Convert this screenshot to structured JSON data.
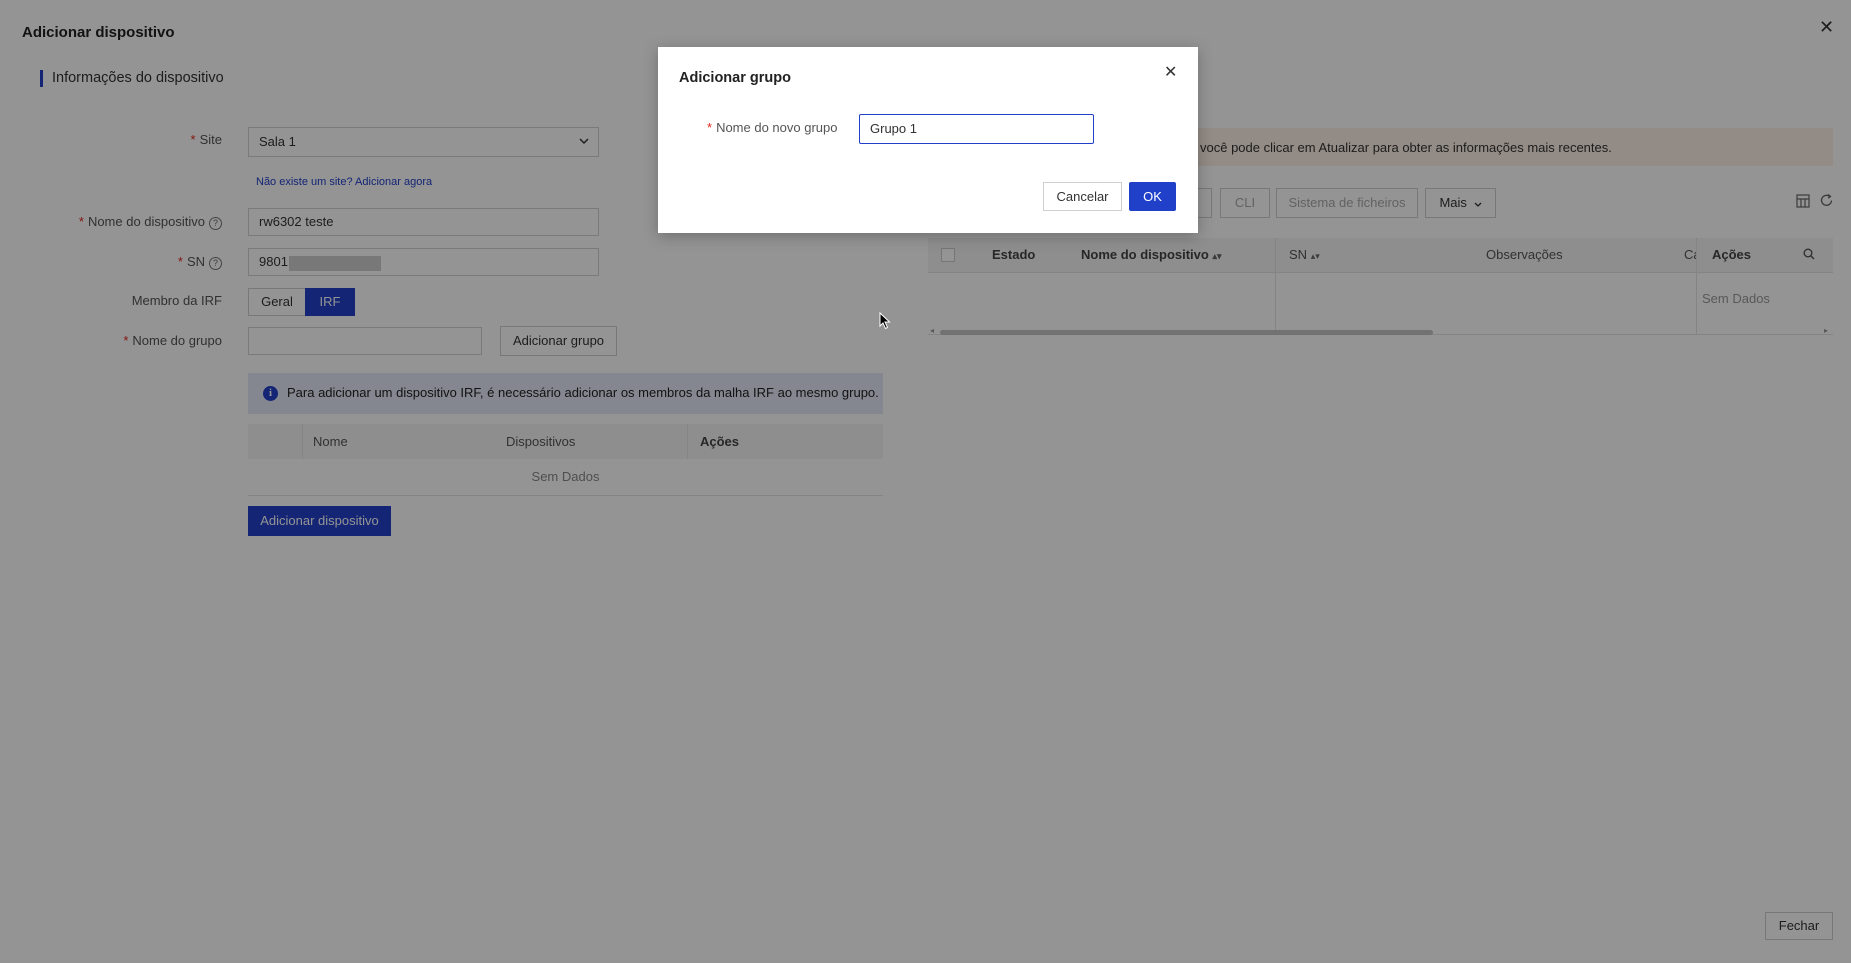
{
  "page": {
    "title": "Adicionar dispositivo"
  },
  "section": {
    "title": "Informações do dispositivo"
  },
  "form": {
    "site_label": "Site",
    "site_value": "Sala 1",
    "site_link": "Não existe um site? Adicionar agora",
    "device_name_label": "Nome do dispositivo",
    "device_name_value": "rw6302 teste",
    "sn_label": "SN",
    "sn_value": "9801",
    "irf_label": "Membro da IRF",
    "irf_options": [
      "Geral",
      "IRF"
    ],
    "irf_selected": "IRF",
    "group_label": "Nome do grupo",
    "group_value": "",
    "add_group_button": "Adicionar grupo",
    "info_text": "Para adicionar um dispositivo IRF, é necessário adicionar os membros da malha IRF ao mesmo grupo.",
    "group_table": {
      "columns": [
        "Nome",
        "Dispositivos",
        "Ações"
      ],
      "empty_text": "Sem Dados"
    },
    "add_device_button": "Adicionar dispositivo"
  },
  "right_panel": {
    "warning_text": "você pode clicar em Atualizar para obter as informações mais recentes.",
    "toolbar": {
      "cli": "CLI",
      "filesystem": "Sistema de ficheiros",
      "more": "Mais"
    },
    "table": {
      "columns": [
        "Estado",
        "Nome do dispositivo",
        "SN",
        "Observações",
        "Ca",
        "Ações"
      ],
      "empty_text": "Sem Dados"
    }
  },
  "footer": {
    "close_button": "Fechar"
  },
  "modal": {
    "title": "Adicionar grupo",
    "field_label": "Nome do novo grupo",
    "field_value": "Grupo 1",
    "cancel_button": "Cancelar",
    "ok_button": "OK"
  },
  "colors": {
    "primary": "#2140c9",
    "required": "#e0281f",
    "warning_bg": "#fdf0e6",
    "info_bg": "#e4e8f7"
  },
  "icons": [
    "close-icon",
    "help-icon",
    "chevron-down-icon",
    "info-icon",
    "sort-icon",
    "search-icon",
    "column-settings-icon",
    "refresh-icon"
  ]
}
